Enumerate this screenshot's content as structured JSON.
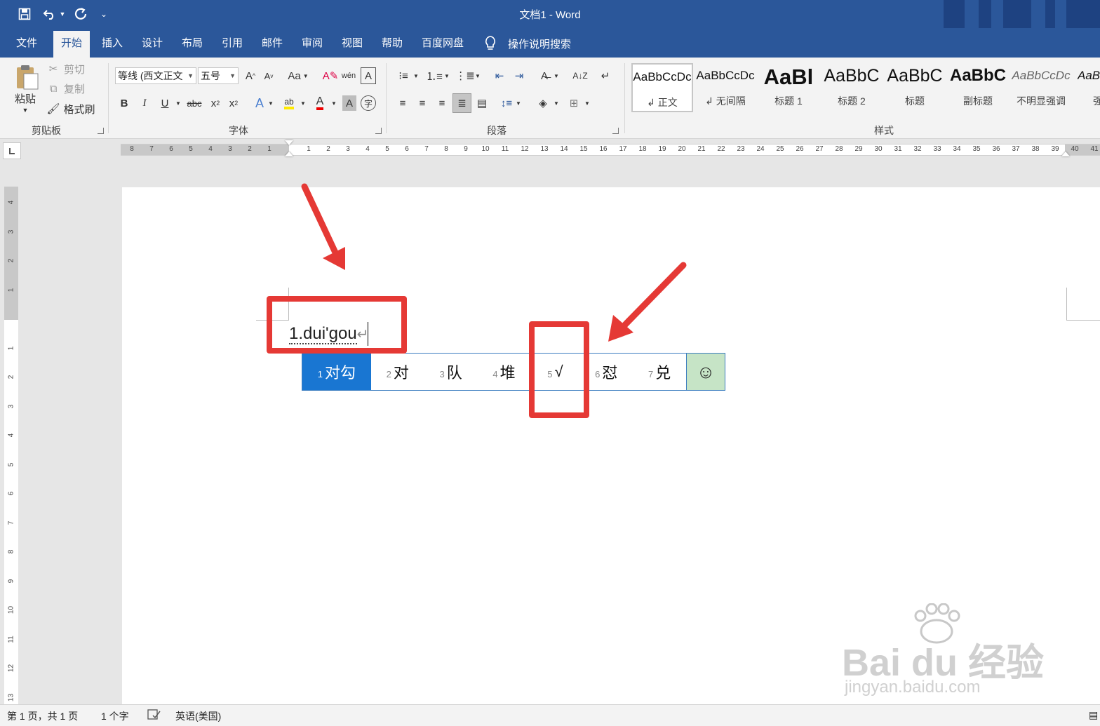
{
  "app": {
    "title": "文档1  -  Word"
  },
  "tabs": [
    "文件",
    "开始",
    "插入",
    "设计",
    "布局",
    "引用",
    "邮件",
    "审阅",
    "视图",
    "帮助",
    "百度网盘"
  ],
  "active_tab": "开始",
  "tell_me": "操作说明搜索",
  "clipboard": {
    "paste": "粘贴",
    "cut": "剪切",
    "copy": "复制",
    "format_painter": "格式刷",
    "label": "剪贴板"
  },
  "font": {
    "name": "等线 (西文正文",
    "size": "五号",
    "change_case": "Aa",
    "label": "字体"
  },
  "paragraph": {
    "label": "段落"
  },
  "styles": {
    "label": "样式",
    "items": [
      {
        "sample": "AaBbCcDc",
        "name": "↲ 正文"
      },
      {
        "sample": "AaBbCcDc",
        "name": "↲ 无间隔"
      },
      {
        "sample": "AaBl",
        "name": "标题 1"
      },
      {
        "sample": "AaBbC",
        "name": "标题 2"
      },
      {
        "sample": "AaBbC",
        "name": "标题"
      },
      {
        "sample": "AaBbC",
        "name": "副标题"
      },
      {
        "sample": "AaBbCcDc",
        "name": "不明显强调"
      },
      {
        "sample": "AaBb",
        "name": "强"
      }
    ]
  },
  "document": {
    "text": "1.dui'gou",
    "para_mark": "↵"
  },
  "ime": {
    "candidates": [
      {
        "num": "1",
        "text": "对勾"
      },
      {
        "num": "2",
        "text": "对"
      },
      {
        "num": "3",
        "text": "队"
      },
      {
        "num": "4",
        "text": "堆"
      },
      {
        "num": "5",
        "text": "√"
      },
      {
        "num": "6",
        "text": "怼"
      },
      {
        "num": "7",
        "text": "兑"
      }
    ],
    "selected_index": 0,
    "emoji": "☺"
  },
  "ruler": {
    "h_left": [
      "8",
      "7",
      "6",
      "5",
      "4",
      "3",
      "2",
      "1"
    ],
    "h_right": [
      "1",
      "2",
      "3",
      "4",
      "5",
      "6",
      "7",
      "8",
      "9",
      "10",
      "11",
      "12",
      "13",
      "14",
      "15",
      "16",
      "17",
      "18",
      "19",
      "20",
      "21",
      "22",
      "23",
      "24",
      "25",
      "26",
      "27",
      "28",
      "29",
      "30",
      "31",
      "32",
      "33",
      "34",
      "35",
      "36",
      "37",
      "38",
      "39",
      "40",
      "41"
    ],
    "v_top": [
      "4",
      "3",
      "2",
      "1"
    ],
    "v_bottom": [
      "1",
      "2",
      "3",
      "4",
      "5",
      "6",
      "7",
      "8",
      "9",
      "10",
      "11",
      "12",
      "13"
    ]
  },
  "watermark": {
    "brand": "Bai du 经验",
    "url": "jingyan.baidu.com"
  },
  "status": {
    "page": "第 1 页，共 1 页",
    "words": "1 个字",
    "language": "英语(美国)"
  },
  "colors": {
    "ribbon_blue": "#2b579a",
    "ime_selected": "#1976d2",
    "annotation_red": "#e53935",
    "emoji_bg": "#c6e4c6"
  }
}
